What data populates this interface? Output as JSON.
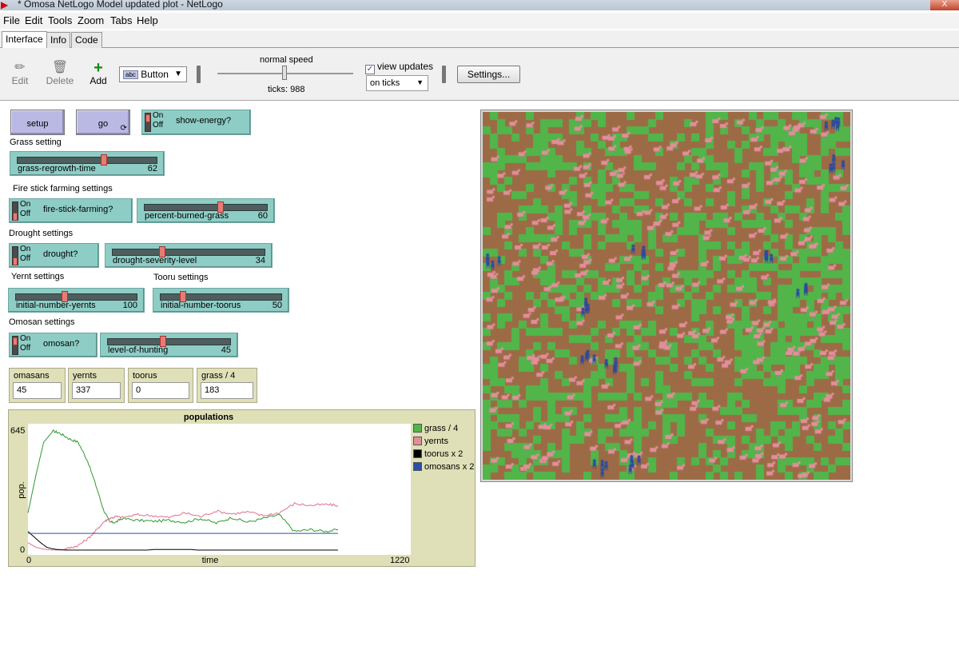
{
  "window": {
    "title": "* Omosa NetLogo Model updated plot - NetLogo",
    "close_glyph": "X"
  },
  "menu": [
    "File",
    "Edit",
    "Tools",
    "Zoom",
    "Tabs",
    "Help"
  ],
  "tabs": [
    "Interface",
    "Info",
    "Code"
  ],
  "toolbar": {
    "edit": "Edit",
    "delete": "Delete",
    "add": "Add",
    "widget_type": "Button",
    "speed_label": "normal speed",
    "ticks": "ticks: 988",
    "view_updates": "view updates",
    "update_mode": "on ticks",
    "settings": "Settings..."
  },
  "buttons": {
    "setup": "setup",
    "go": "go"
  },
  "switch_labels": {
    "on": "On",
    "off": "Off"
  },
  "switches": {
    "show_energy": {
      "label": "show-energy?",
      "state": "on"
    },
    "fire_stick": {
      "label": "fire-stick-farming?",
      "state": "off"
    },
    "drought": {
      "label": "drought?",
      "state": "off"
    },
    "omosan": {
      "label": "omosan?",
      "state": "on"
    }
  },
  "notes": {
    "grass": "Grass setting",
    "fire": "Fire stick farming settings",
    "drought": "Drought settings",
    "yernt": "Yernt settings",
    "tooru": "Tooru settings",
    "omosan": "Omosan settings"
  },
  "sliders": {
    "grass_regrowth": {
      "name": "grass-regrowth-time",
      "value": "62",
      "fraction": 0.62
    },
    "percent_burned": {
      "name": "percent-burned-grass",
      "value": "60",
      "fraction": 0.6
    },
    "drought_severity": {
      "name": "drought-severity-level",
      "value": "34",
      "fraction": 0.34
    },
    "yernts": {
      "name": "initial-number-yernts",
      "value": "100",
      "fraction": 0.33
    },
    "toorus": {
      "name": "initial-number-toorus",
      "value": "50",
      "fraction": 0.17
    },
    "hunting": {
      "name": "level-of-hunting",
      "value": "45",
      "fraction": 0.45
    }
  },
  "monitors": [
    {
      "label": "omasans",
      "value": "45"
    },
    {
      "label": "yernts",
      "value": "337"
    },
    {
      "label": "toorus",
      "value": "0"
    },
    {
      "label": "grass / 4",
      "value": "183"
    }
  ],
  "chart_data": {
    "type": "line",
    "title": "populations",
    "xlabel": "time",
    "ylabel": "pop.",
    "xlim": [
      0,
      1220
    ],
    "ylim": [
      0,
      645
    ],
    "x_tick_labels": [
      "0",
      "1220"
    ],
    "y_tick_labels": [
      "0",
      "645"
    ],
    "legend_position": "right",
    "series": [
      {
        "name": "grass / 4",
        "color": "#2f9a2f",
        "x": [
          0,
          25,
          50,
          80,
          100,
          130,
          160,
          190,
          220,
          240,
          260,
          280,
          300,
          350,
          400,
          450,
          500,
          550,
          600,
          650,
          700,
          750,
          800,
          850,
          900,
          950,
          988
        ],
        "y": [
          200,
          400,
          580,
          640,
          630,
          600,
          580,
          480,
          330,
          220,
          150,
          150,
          170,
          160,
          155,
          160,
          150,
          170,
          145,
          175,
          150,
          170,
          190,
          100,
          110,
          100,
          110
        ]
      },
      {
        "name": "yernts",
        "color": "#e06f8b",
        "x": [
          0,
          25,
          50,
          80,
          100,
          130,
          160,
          190,
          220,
          240,
          260,
          280,
          300,
          350,
          400,
          450,
          500,
          550,
          600,
          650,
          700,
          750,
          800,
          850,
          900,
          950,
          988
        ],
        "y": [
          40,
          15,
          5,
          0,
          0,
          10,
          25,
          60,
          110,
          150,
          170,
          180,
          175,
          190,
          185,
          175,
          200,
          180,
          210,
          195,
          205,
          185,
          200,
          250,
          240,
          245,
          240
        ]
      },
      {
        "name": "toorus x 2",
        "color": "#000000",
        "x": [
          0,
          20,
          40,
          60,
          80,
          100,
          120,
          150,
          300,
          380,
          400,
          520,
          540,
          600,
          700,
          800,
          900,
          988
        ],
        "y": [
          100,
          70,
          40,
          15,
          6,
          2,
          0,
          0,
          0,
          0,
          3,
          3,
          0,
          0,
          0,
          0,
          0,
          0
        ]
      },
      {
        "name": "omosans x 2",
        "color": "#2b4fa6",
        "x": [
          0,
          988
        ],
        "y": [
          90,
          90
        ]
      }
    ]
  },
  "world": {
    "patch_colors": {
      "grass": "#52b54a",
      "dirt": "#9c6b45"
    },
    "yernt_color": "#e38e9b",
    "omosan_color": "#2b4aa0",
    "omosan_count": 45,
    "yernt_count": 337,
    "grass_count": 183
  }
}
